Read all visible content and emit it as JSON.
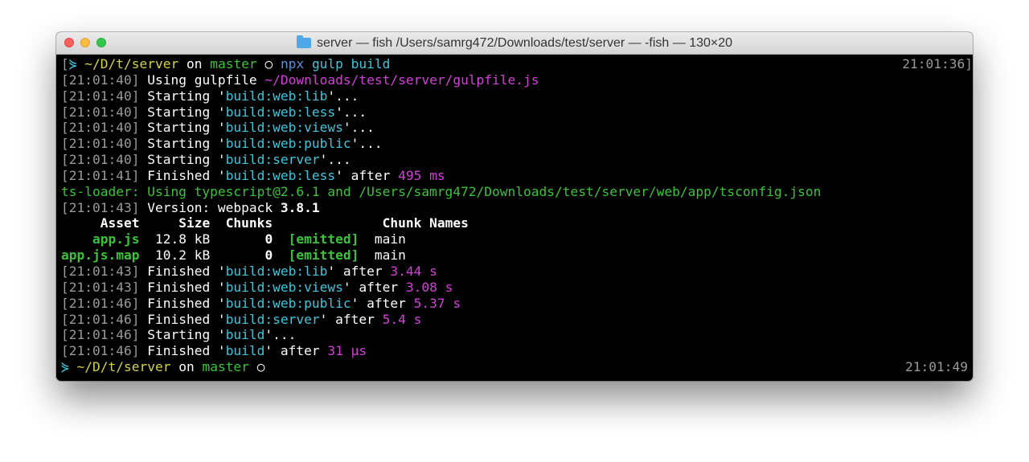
{
  "window": {
    "title": "server — fish  /Users/samrg472/Downloads/test/server — -fish — 130×20",
    "title_icon": "folder-icon",
    "buttons": {
      "close_color": "#fc605c",
      "minimize_color": "#fdbc40",
      "zoom_color": "#34c84a"
    }
  },
  "prompt1": {
    "open_bracket": "[",
    "symbol": "⋟",
    "path": "~/D/t/server",
    "on": "on",
    "branch": "master",
    "status": "○",
    "cmd_npx": "npx",
    "cmd_args": "gulp build",
    "time": "21:01:36]"
  },
  "log": [
    {
      "time": "21:01:40",
      "verb": "Using gulpfile",
      "task": "~/Downloads/test/server/gulpfile.js",
      "suffix": ""
    },
    {
      "time": "21:01:40",
      "verb": "Starting",
      "task": "build:web:lib",
      "suffix": "..."
    },
    {
      "time": "21:01:40",
      "verb": "Starting",
      "task": "build:web:less",
      "suffix": "..."
    },
    {
      "time": "21:01:40",
      "verb": "Starting",
      "task": "build:web:views",
      "suffix": "..."
    },
    {
      "time": "21:01:40",
      "verb": "Starting",
      "task": "build:web:public",
      "suffix": "..."
    },
    {
      "time": "21:01:40",
      "verb": "Starting",
      "task": "build:server",
      "suffix": "..."
    },
    {
      "time": "21:01:41",
      "verb": "Finished",
      "task": "build:web:less",
      "after": "after",
      "duration": "495 ms"
    }
  ],
  "tsloader": "ts-loader: Using typescript@2.6.1 and /Users/samrg472/Downloads/test/server/web/app/tsconfig.json",
  "webpack": {
    "time": "21:01:43",
    "label": "Version: webpack",
    "version": "3.8.1",
    "header": {
      "asset": "Asset",
      "size": "Size",
      "chunks": "Chunks",
      "chunk_names": "Chunk Names"
    },
    "rows": [
      {
        "asset": "app.js",
        "size": "12.8 kB",
        "chunks": "0",
        "emitted": "[emitted]",
        "name": "main"
      },
      {
        "asset": "app.js.map",
        "size": "10.2 kB",
        "chunks": "0",
        "emitted": "[emitted]",
        "name": "main"
      }
    ]
  },
  "log2": [
    {
      "time": "21:01:43",
      "verb": "Finished",
      "task": "build:web:lib",
      "after": "after",
      "duration": "3.44 s"
    },
    {
      "time": "21:01:43",
      "verb": "Finished",
      "task": "build:web:views",
      "after": "after",
      "duration": "3.08 s"
    },
    {
      "time": "21:01:46",
      "verb": "Finished",
      "task": "build:web:public",
      "after": "after",
      "duration": "5.37 s"
    },
    {
      "time": "21:01:46",
      "verb": "Finished",
      "task": "build:server",
      "after": "after",
      "duration": "5.4 s"
    },
    {
      "time": "21:01:46",
      "verb": "Starting",
      "task": "build",
      "suffix": "..."
    },
    {
      "time": "21:01:46",
      "verb": "Finished",
      "task": "build",
      "after": "after",
      "duration": "31 μs"
    }
  ],
  "prompt2": {
    "symbol": "⋟",
    "path": "~/D/t/server",
    "on": "on",
    "branch": "master",
    "status": "○",
    "time": "21:01:49"
  }
}
